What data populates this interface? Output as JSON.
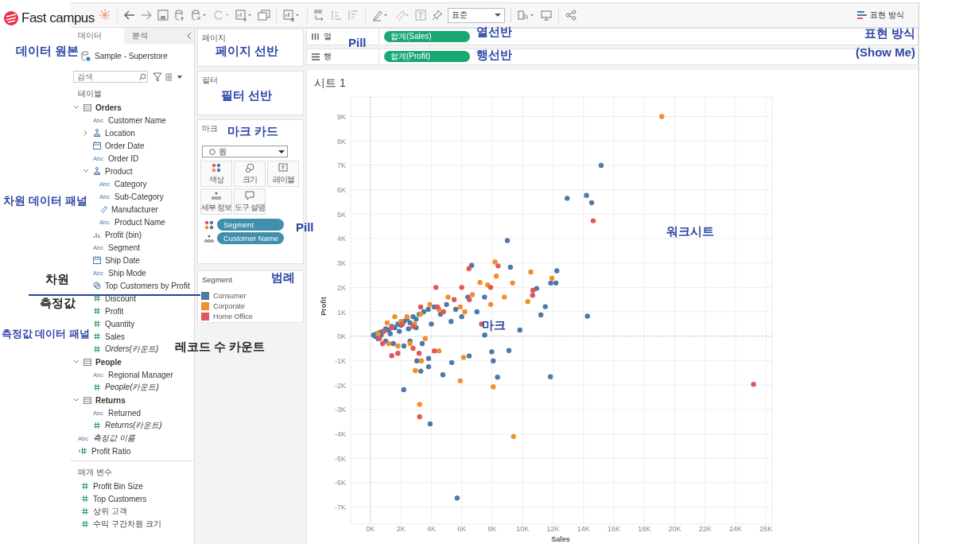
{
  "logo": {
    "text": "Fast campus"
  },
  "toolbar": {
    "fit_select": {
      "value": "표준"
    },
    "show_me": {
      "label": "표현 방식"
    }
  },
  "data_pane": {
    "tabs": [
      {
        "label": "데이터",
        "selected": true
      },
      {
        "label": "분석",
        "selected": false
      }
    ],
    "source": "Sample - Superstore",
    "search": {
      "placeholder": "검색"
    },
    "section_label": "테이블",
    "tables": [
      {
        "name": "Orders",
        "expanded": true,
        "children": [
          {
            "name": "Customer Name",
            "kind": "abc",
            "type_label": "Abc"
          },
          {
            "name": "Location",
            "kind": "geo",
            "expanded": false
          },
          {
            "name": "Order Date",
            "kind": "date"
          },
          {
            "name": "Order ID",
            "kind": "abc",
            "type_label": "Abc"
          },
          {
            "name": "Product",
            "kind": "geo",
            "expanded": true,
            "children": [
              {
                "name": "Category",
                "kind": "abc",
                "type_label": "Abc"
              },
              {
                "name": "Sub-Category",
                "kind": "abc",
                "type_label": "Abc"
              },
              {
                "name": "Manufacturer",
                "kind": "clip"
              },
              {
                "name": "Product Name",
                "kind": "abc",
                "type_label": "Abc"
              }
            ]
          },
          {
            "name": "Profit (bin)",
            "kind": "bin"
          },
          {
            "name": "Segment",
            "kind": "abc",
            "type_label": "Abc"
          },
          {
            "name": "Ship Date",
            "kind": "date"
          },
          {
            "name": "Ship Mode",
            "kind": "abc",
            "type_label": "Abc"
          },
          {
            "name": "Top Customers by Profit",
            "kind": "set"
          },
          {
            "name": "Discount",
            "kind": "measure"
          },
          {
            "name": "Profit",
            "kind": "measure"
          },
          {
            "name": "Quantity",
            "kind": "measure"
          },
          {
            "name": "Sales",
            "kind": "measure"
          },
          {
            "name": "Orders(카운트)",
            "kind": "measure",
            "italic": true
          }
        ]
      },
      {
        "name": "People",
        "expanded": true,
        "children": [
          {
            "name": "Regional Manager",
            "kind": "abc",
            "type_label": "Abc"
          },
          {
            "name": "People(카운트)",
            "kind": "measure",
            "italic": true
          }
        ]
      },
      {
        "name": "Returns",
        "expanded": true,
        "children": [
          {
            "name": "Returned",
            "kind": "abc",
            "type_label": "Abc"
          },
          {
            "name": "Returns(카운트)",
            "kind": "measure",
            "italic": true
          }
        ]
      }
    ],
    "loose": [
      {
        "name": "측정값 이름",
        "kind": "abc",
        "type_label": "Abc",
        "italic": true
      },
      {
        "name": "Profit Ratio",
        "kind": "calc"
      }
    ],
    "parameters": {
      "label": "매개 변수",
      "items": [
        {
          "name": "Profit Bin Size",
          "kind": "measure"
        },
        {
          "name": "Top Customers",
          "kind": "measure"
        },
        {
          "name": "상위 고객",
          "kind": "measure"
        },
        {
          "name": "수익 구간차원 크기",
          "kind": "measure"
        }
      ]
    }
  },
  "pages": {
    "title": "페이지"
  },
  "filters": {
    "title": "필터"
  },
  "marks": {
    "title": "마크",
    "mark_type": "원",
    "buttons": [
      {
        "label": "색상",
        "kind": "color"
      },
      {
        "label": "크기",
        "kind": "size"
      },
      {
        "label": "레이블",
        "kind": "label"
      },
      {
        "label": "세부 정보",
        "kind": "detail"
      },
      {
        "label": "도구 설명",
        "kind": "tooltip"
      }
    ],
    "pills": [
      {
        "label": "Segment",
        "kind": "color"
      },
      {
        "label": "Customer Name",
        "kind": "detail"
      }
    ]
  },
  "legend": {
    "title": "Segment"
  },
  "shelves": [
    {
      "label": "열",
      "kind": "columns",
      "pill": "합계(Sales)"
    },
    {
      "label": "행",
      "kind": "rows",
      "pill": "합계(Profit)"
    }
  ],
  "sheet": {
    "title": "시트 1",
    "chart_data": {
      "type": "scatter",
      "xlabel": "Sales",
      "ylabel": "Profit",
      "xlim": [
        -1.3,
        26.4
      ],
      "ylim": [
        -7.7,
        9.8
      ],
      "grid": true,
      "xticks": [
        {
          "value": 0,
          "label": "0K"
        },
        {
          "value": 2,
          "label": "2K"
        },
        {
          "value": 4,
          "label": "4K"
        },
        {
          "value": 6,
          "label": "6K"
        },
        {
          "value": 8,
          "label": "8K"
        },
        {
          "value": 10,
          "label": "10K"
        },
        {
          "value": 12,
          "label": "12K"
        },
        {
          "value": 14,
          "label": "14K"
        },
        {
          "value": 16,
          "label": "16K"
        },
        {
          "value": 18,
          "label": "18K"
        },
        {
          "value": 20,
          "label": "20K"
        },
        {
          "value": 22,
          "label": "22K"
        },
        {
          "value": 24,
          "label": "24K"
        },
        {
          "value": 26,
          "label": "26K"
        }
      ],
      "yticks": [
        {
          "value": 9,
          "label": "9K"
        },
        {
          "value": 8,
          "label": "8K"
        },
        {
          "value": 7,
          "label": "7K"
        },
        {
          "value": 6,
          "label": "6K"
        },
        {
          "value": 5,
          "label": "5K"
        },
        {
          "value": 4,
          "label": "4K"
        },
        {
          "value": 3,
          "label": "3K"
        },
        {
          "value": 2,
          "label": "2K"
        },
        {
          "value": 1,
          "label": "1K"
        },
        {
          "value": 0,
          "label": "0K"
        },
        {
          "value": -1,
          "label": "-1K"
        },
        {
          "value": -2,
          "label": "-2K"
        },
        {
          "value": -3,
          "label": "-3K"
        },
        {
          "value": -4,
          "label": "-4K"
        },
        {
          "value": -5,
          "label": "-5K"
        },
        {
          "value": -6,
          "label": "-6K"
        },
        {
          "value": -7,
          "label": "-7K"
        }
      ],
      "series": [
        {
          "name": "Consumer",
          "color": "#4e79a7",
          "x": [
            15.16,
            12.93,
            14.2,
            14.54,
            9.0,
            6.65,
            9.2,
            12.25,
            11.85,
            12.19,
            10.92,
            11.49,
            11.2,
            14.26,
            9.82,
            7.51,
            7.97,
            9.1,
            8.07,
            8.35,
            11.83,
            4.76,
            5.34,
            6.49,
            2.19,
            3.92,
            5.7,
            3.31,
            3.82,
            3.82,
            3.05,
            0.2,
            0.4,
            0.6,
            0.8,
            1.0,
            1.2,
            1.4,
            1.6,
            1.8,
            2.0,
            2.2,
            2.4,
            2.6,
            2.8,
            3.0,
            3.2,
            3.5,
            3.8,
            4.2,
            4.6,
            5.0,
            5.3,
            5.6,
            6.0,
            6.4,
            7.0,
            7.5,
            0.5,
            1.0,
            1.5,
            2.2,
            2.6,
            3.4,
            0.3,
            0.7,
            1.3,
            1.9,
            2.5,
            3.0,
            4.0
          ],
          "values": [
            7.0,
            5.65,
            5.77,
            5.47,
            3.92,
            2.9,
            2.83,
            2.68,
            2.18,
            2.18,
            1.96,
            1.21,
            0.87,
            0.82,
            0.25,
            0.05,
            -0.64,
            -0.59,
            -1.01,
            -1.68,
            -1.66,
            -1.58,
            -1.08,
            -0.81,
            -2.19,
            -3.59,
            -6.63,
            -1.43,
            -1.25,
            -0.91,
            -1.01,
            0.05,
            0.1,
            0.15,
            0.2,
            0.3,
            0.25,
            0.4,
            0.35,
            0.5,
            0.45,
            0.6,
            0.7,
            0.55,
            0.8,
            0.7,
            0.9,
            1.0,
            1.1,
            1.2,
            0.9,
            1.3,
            0.6,
            1.1,
            0.8,
            1.6,
            1.0,
            1.6,
            -0.1,
            -0.2,
            -0.3,
            -0.4,
            -0.2,
            -0.3,
            0.0,
            0.05,
            0.1,
            0.2,
            0.3,
            0.35,
            0.5
          ]
        },
        {
          "name": "Corporate",
          "color": "#f28e2b",
          "x": [
            19.15,
            8.19,
            10.54,
            11.93,
            8.27,
            9.34,
            10.34,
            8.07,
            5.9,
            6.12,
            3.23,
            9.4,
            2.95,
            3.35,
            0.5,
            1.1,
            1.6,
            2.0,
            2.4,
            2.9,
            3.3,
            3.9,
            4.5,
            5.1,
            5.9,
            6.7,
            7.2,
            7.7,
            8.8,
            1.2,
            1.8,
            2.6,
            3.6,
            4.5,
            6.2,
            7.9
          ],
          "values": [
            9.0,
            3.04,
            2.63,
            2.38,
            2.46,
            2.18,
            1.42,
            -2.08,
            -1.83,
            -0.87,
            -2.79,
            -4.11,
            -1.41,
            -1.01,
            0.1,
            0.55,
            0.8,
            0.6,
            0.8,
            0.5,
            0.9,
            1.3,
            1.1,
            1.6,
            1.2,
            1.7,
            2.2,
            2.1,
            1.6,
            -0.3,
            -0.4,
            -0.3,
            -0.1,
            -0.6,
            1.0,
            1.3
          ]
        },
        {
          "name": "Home Office",
          "color": "#e15759",
          "x": [
            14.64,
            6.47,
            8.39,
            10.68,
            10.66,
            25.18,
            3.23,
            0.6,
            0.9,
            1.4,
            2.1,
            2.8,
            3.3,
            4.3,
            4.8,
            5.5,
            6.0,
            6.5,
            7.3,
            7.9,
            0.8,
            1.4,
            1.8,
            2.8,
            3.2,
            4.2,
            4.4
          ],
          "values": [
            4.73,
            2.77,
            2.88,
            1.88,
            1.68,
            -1.97,
            -3.3,
            -0.1,
            0.2,
            0.35,
            0.5,
            0.4,
            1.2,
            2.0,
            1.0,
            1.5,
            2.0,
            1.5,
            0.5,
            2.0,
            -0.3,
            -0.8,
            -0.7,
            -0.5,
            -0.7,
            -0.6,
            1.2
          ]
        }
      ]
    }
  },
  "annotations": [
    {
      "text": "데이터 원본",
      "kind": "callout"
    },
    {
      "text": "페이지 선반",
      "kind": "callout"
    },
    {
      "text": "필터 선반",
      "kind": "callout"
    },
    {
      "text": "마크 카드",
      "kind": "callout"
    },
    {
      "text": "Pill",
      "kind": "callout"
    },
    {
      "text": "Pill",
      "kind": "callout"
    },
    {
      "text": "열선반",
      "kind": "callout"
    },
    {
      "text": "행선반",
      "kind": "callout"
    },
    {
      "text": "표현 방식",
      "kind": "callout"
    },
    {
      "text": "(Show Me)",
      "kind": "callout"
    },
    {
      "text": "차원 데이터 패널",
      "kind": "callout"
    },
    {
      "text": "차원",
      "kind": "note"
    },
    {
      "text": "측정값",
      "kind": "note"
    },
    {
      "text": "측정값 데이터 패널",
      "kind": "callout"
    },
    {
      "text": "레코드 수 카운트",
      "kind": "note"
    },
    {
      "text": "범례",
      "kind": "callout"
    },
    {
      "text": "워크시트",
      "kind": "callout"
    },
    {
      "text": "마크",
      "kind": "callout"
    }
  ]
}
